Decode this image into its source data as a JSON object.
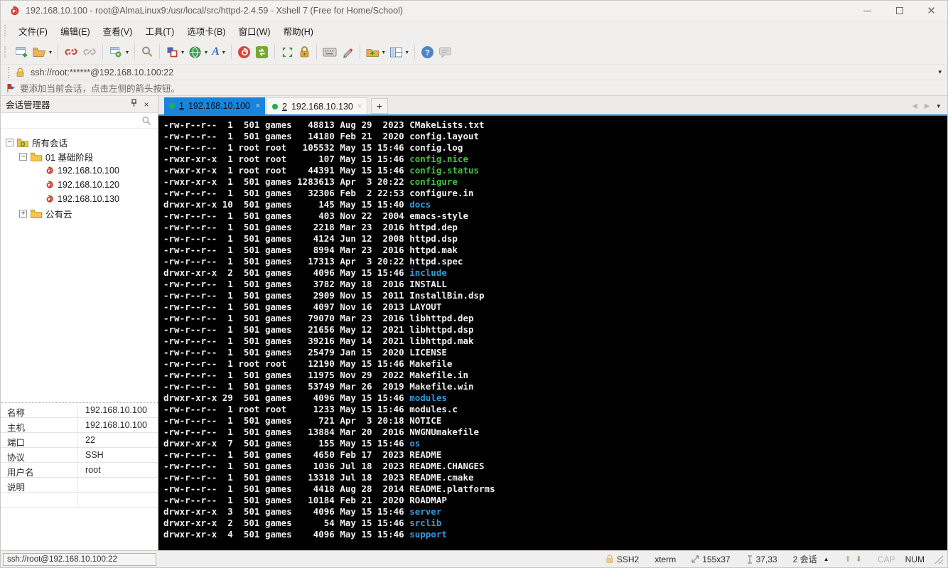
{
  "window": {
    "title": "192.168.10.100 - root@AlmaLinux9:/usr/local/src/httpd-2.4.59 - Xshell 7 (Free for Home/School)",
    "controls": [
      "minimize",
      "maximize",
      "close"
    ]
  },
  "menu": {
    "items": [
      "文件(F)",
      "编辑(E)",
      "查看(V)",
      "工具(T)",
      "选项卡(B)",
      "窗口(W)",
      "帮助(H)"
    ]
  },
  "toolbar": {
    "icons": [
      "new-session",
      "open-session-folder",
      "disconnect",
      "reconnect",
      "session-properties",
      "find",
      "color-scheme",
      "encoding-globe",
      "font",
      "xshell",
      "xftp",
      "fullscreen",
      "lock-screen",
      "virtual-keyboard",
      "compose",
      "new-session-shortcut",
      "layout",
      "help",
      "feedback"
    ]
  },
  "address_bar": {
    "url": "ssh://root:******@192.168.10.100:22"
  },
  "hint_bar": {
    "text": "要添加当前会话，点击左侧的箭头按钮。"
  },
  "session_manager": {
    "title": "会话管理器",
    "tree": [
      {
        "label": "所有会话",
        "level": 0,
        "type": "folder-root",
        "expander": "-"
      },
      {
        "label": "01 基础阶段",
        "level": 1,
        "type": "folder",
        "expander": "-"
      },
      {
        "label": "192.168.10.100",
        "level": 2,
        "type": "session",
        "expander": ""
      },
      {
        "label": "192.168.10.120",
        "level": 2,
        "type": "session",
        "expander": ""
      },
      {
        "label": "192.168.10.130",
        "level": 2,
        "type": "session",
        "expander": ""
      },
      {
        "label": "公有云",
        "level": 1,
        "type": "folder",
        "expander": "+"
      }
    ],
    "properties": [
      {
        "label": "名称",
        "value": "192.168.10.100"
      },
      {
        "label": "主机",
        "value": "192.168.10.100"
      },
      {
        "label": "端口",
        "value": "22"
      },
      {
        "label": "协议",
        "value": "SSH"
      },
      {
        "label": "用户名",
        "value": "root"
      },
      {
        "label": "说明",
        "value": ""
      }
    ]
  },
  "tabs": [
    {
      "number": "1",
      "label": "192.168.10.100",
      "active": true,
      "connected": true
    },
    {
      "number": "2",
      "label": "192.168.10.130",
      "active": false,
      "connected": true
    }
  ],
  "terminal": {
    "colors": {
      "background": "#000000",
      "text": "#f0f0f0",
      "executable": "#3fc43f",
      "directory": "#2f9cdb",
      "accent": "#1a84dc"
    },
    "lines": [
      {
        "prefix": "-rw-r--r--  1  501 games   48813 Aug 29  2023 ",
        "name": "CMakeLists.txt",
        "type": "file"
      },
      {
        "prefix": "-rw-r--r--  1  501 games   14180 Feb 21  2020 ",
        "name": "config.layout",
        "type": "file"
      },
      {
        "prefix": "-rw-r--r--  1 root root   105532 May 15 15:46 ",
        "name": "config.log",
        "type": "file"
      },
      {
        "prefix": "-rwxr-xr-x  1 root root      107 May 15 15:46 ",
        "name": "config.nice",
        "type": "exec"
      },
      {
        "prefix": "-rwxr-xr-x  1 root root    44391 May 15 15:46 ",
        "name": "config.status",
        "type": "exec"
      },
      {
        "prefix": "-rwxr-xr-x  1  501 games 1283613 Apr  3 20:22 ",
        "name": "configure",
        "type": "exec"
      },
      {
        "prefix": "-rw-r--r--  1  501 games   32306 Feb  2 22:53 ",
        "name": "configure.in",
        "type": "file"
      },
      {
        "prefix": "drwxr-xr-x 10  501 games     145 May 15 15:40 ",
        "name": "docs",
        "type": "dir"
      },
      {
        "prefix": "-rw-r--r--  1  501 games     403 Nov 22  2004 ",
        "name": "emacs-style",
        "type": "file"
      },
      {
        "prefix": "-rw-r--r--  1  501 games    2218 Mar 23  2016 ",
        "name": "httpd.dep",
        "type": "file"
      },
      {
        "prefix": "-rw-r--r--  1  501 games    4124 Jun 12  2008 ",
        "name": "httpd.dsp",
        "type": "file"
      },
      {
        "prefix": "-rw-r--r--  1  501 games    8994 Mar 23  2016 ",
        "name": "httpd.mak",
        "type": "file"
      },
      {
        "prefix": "-rw-r--r--  1  501 games   17313 Apr  3 20:22 ",
        "name": "httpd.spec",
        "type": "file"
      },
      {
        "prefix": "drwxr-xr-x  2  501 games    4096 May 15 15:46 ",
        "name": "include",
        "type": "dir"
      },
      {
        "prefix": "-rw-r--r--  1  501 games    3782 May 18  2016 ",
        "name": "INSTALL",
        "type": "file"
      },
      {
        "prefix": "-rw-r--r--  1  501 games    2909 Nov 15  2011 ",
        "name": "InstallBin.dsp",
        "type": "file"
      },
      {
        "prefix": "-rw-r--r--  1  501 games    4097 Nov 16  2013 ",
        "name": "LAYOUT",
        "type": "file"
      },
      {
        "prefix": "-rw-r--r--  1  501 games   79070 Mar 23  2016 ",
        "name": "libhttpd.dep",
        "type": "file"
      },
      {
        "prefix": "-rw-r--r--  1  501 games   21656 May 12  2021 ",
        "name": "libhttpd.dsp",
        "type": "file"
      },
      {
        "prefix": "-rw-r--r--  1  501 games   39216 May 14  2021 ",
        "name": "libhttpd.mak",
        "type": "file"
      },
      {
        "prefix": "-rw-r--r--  1  501 games   25479 Jan 15  2020 ",
        "name": "LICENSE",
        "type": "file"
      },
      {
        "prefix": "-rw-r--r--  1 root root    12190 May 15 15:46 ",
        "name": "Makefile",
        "type": "file"
      },
      {
        "prefix": "-rw-r--r--  1  501 games   11975 Nov 29  2022 ",
        "name": "Makefile.in",
        "type": "file"
      },
      {
        "prefix": "-rw-r--r--  1  501 games   53749 Mar 26  2019 ",
        "name": "Makefile.win",
        "type": "file"
      },
      {
        "prefix": "drwxr-xr-x 29  501 games    4096 May 15 15:46 ",
        "name": "modules",
        "type": "dir"
      },
      {
        "prefix": "-rw-r--r--  1 root root     1233 May 15 15:46 ",
        "name": "modules.c",
        "type": "file"
      },
      {
        "prefix": "-rw-r--r--  1  501 games     721 Apr  3 20:18 ",
        "name": "NOTICE",
        "type": "file"
      },
      {
        "prefix": "-rw-r--r--  1  501 games   13884 Mar 20  2016 ",
        "name": "NWGNUmakefile",
        "type": "file"
      },
      {
        "prefix": "drwxr-xr-x  7  501 games     155 May 15 15:46 ",
        "name": "os",
        "type": "dir"
      },
      {
        "prefix": "-rw-r--r--  1  501 games    4650 Feb 17  2023 ",
        "name": "README",
        "type": "file"
      },
      {
        "prefix": "-rw-r--r--  1  501 games    1036 Jul 18  2023 ",
        "name": "README.CHANGES",
        "type": "file"
      },
      {
        "prefix": "-rw-r--r--  1  501 games   13318 Jul 18  2023 ",
        "name": "README.cmake",
        "type": "file"
      },
      {
        "prefix": "-rw-r--r--  1  501 games    4418 Aug 28  2014 ",
        "name": "README.platforms",
        "type": "file"
      },
      {
        "prefix": "-rw-r--r--  1  501 games   10184 Feb 21  2020 ",
        "name": "ROADMAP",
        "type": "file"
      },
      {
        "prefix": "drwxr-xr-x  3  501 games    4096 May 15 15:46 ",
        "name": "server",
        "type": "dir"
      },
      {
        "prefix": "drwxr-xr-x  2  501 games      54 May 15 15:46 ",
        "name": "srclib",
        "type": "dir"
      },
      {
        "prefix": "drwxr-xr-x  4  501 games    4096 May 15 15:46 ",
        "name": "support",
        "type": "dir"
      }
    ]
  },
  "status_bar": {
    "connection": "ssh://root@192.168.10.100:22",
    "protocol": "SSH2",
    "terminal_type": "xterm",
    "size": "155x37",
    "cursor": "37,33",
    "sessions": "2 会话",
    "cap": "CAP",
    "num": "NUM",
    "cap_active": false,
    "num_active": true
  }
}
